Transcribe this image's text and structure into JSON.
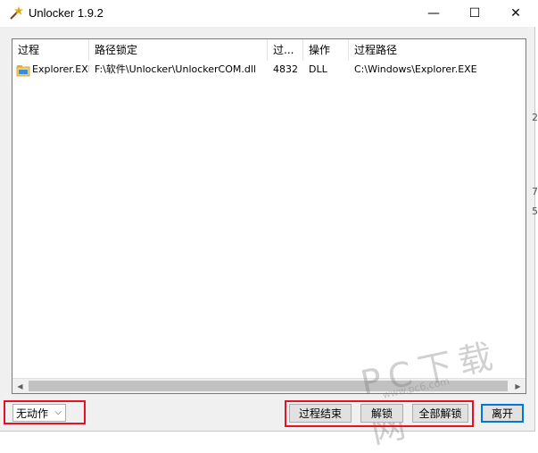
{
  "window": {
    "title": "Unlocker 1.9.2",
    "controls": {
      "minimize": "—",
      "maximize": "☐",
      "close": "✕"
    }
  },
  "table": {
    "columns": [
      "过程",
      "路径锁定",
      "过...",
      "操作",
      "过程路径"
    ],
    "rows": [
      {
        "process": "Explorer.EXE",
        "locked_path": "F:\\软件\\Unlocker\\UnlockerCOM.dll",
        "pid": "4832",
        "type": "DLL",
        "process_path": "C:\\Windows\\Explorer.EXE"
      }
    ]
  },
  "footer": {
    "action_select": "无动作",
    "buttons": {
      "kill": "过程结束",
      "unlock": "解锁",
      "unlock_all": "全部解锁",
      "quit": "离开"
    }
  },
  "watermark": {
    "main": "PC下载网",
    "sub": "www.pc6.com"
  },
  "background_fragments": [
    "2",
    "7",
    "5"
  ],
  "colors": {
    "highlight_red": "#e81123",
    "accent": "#0078d7"
  }
}
